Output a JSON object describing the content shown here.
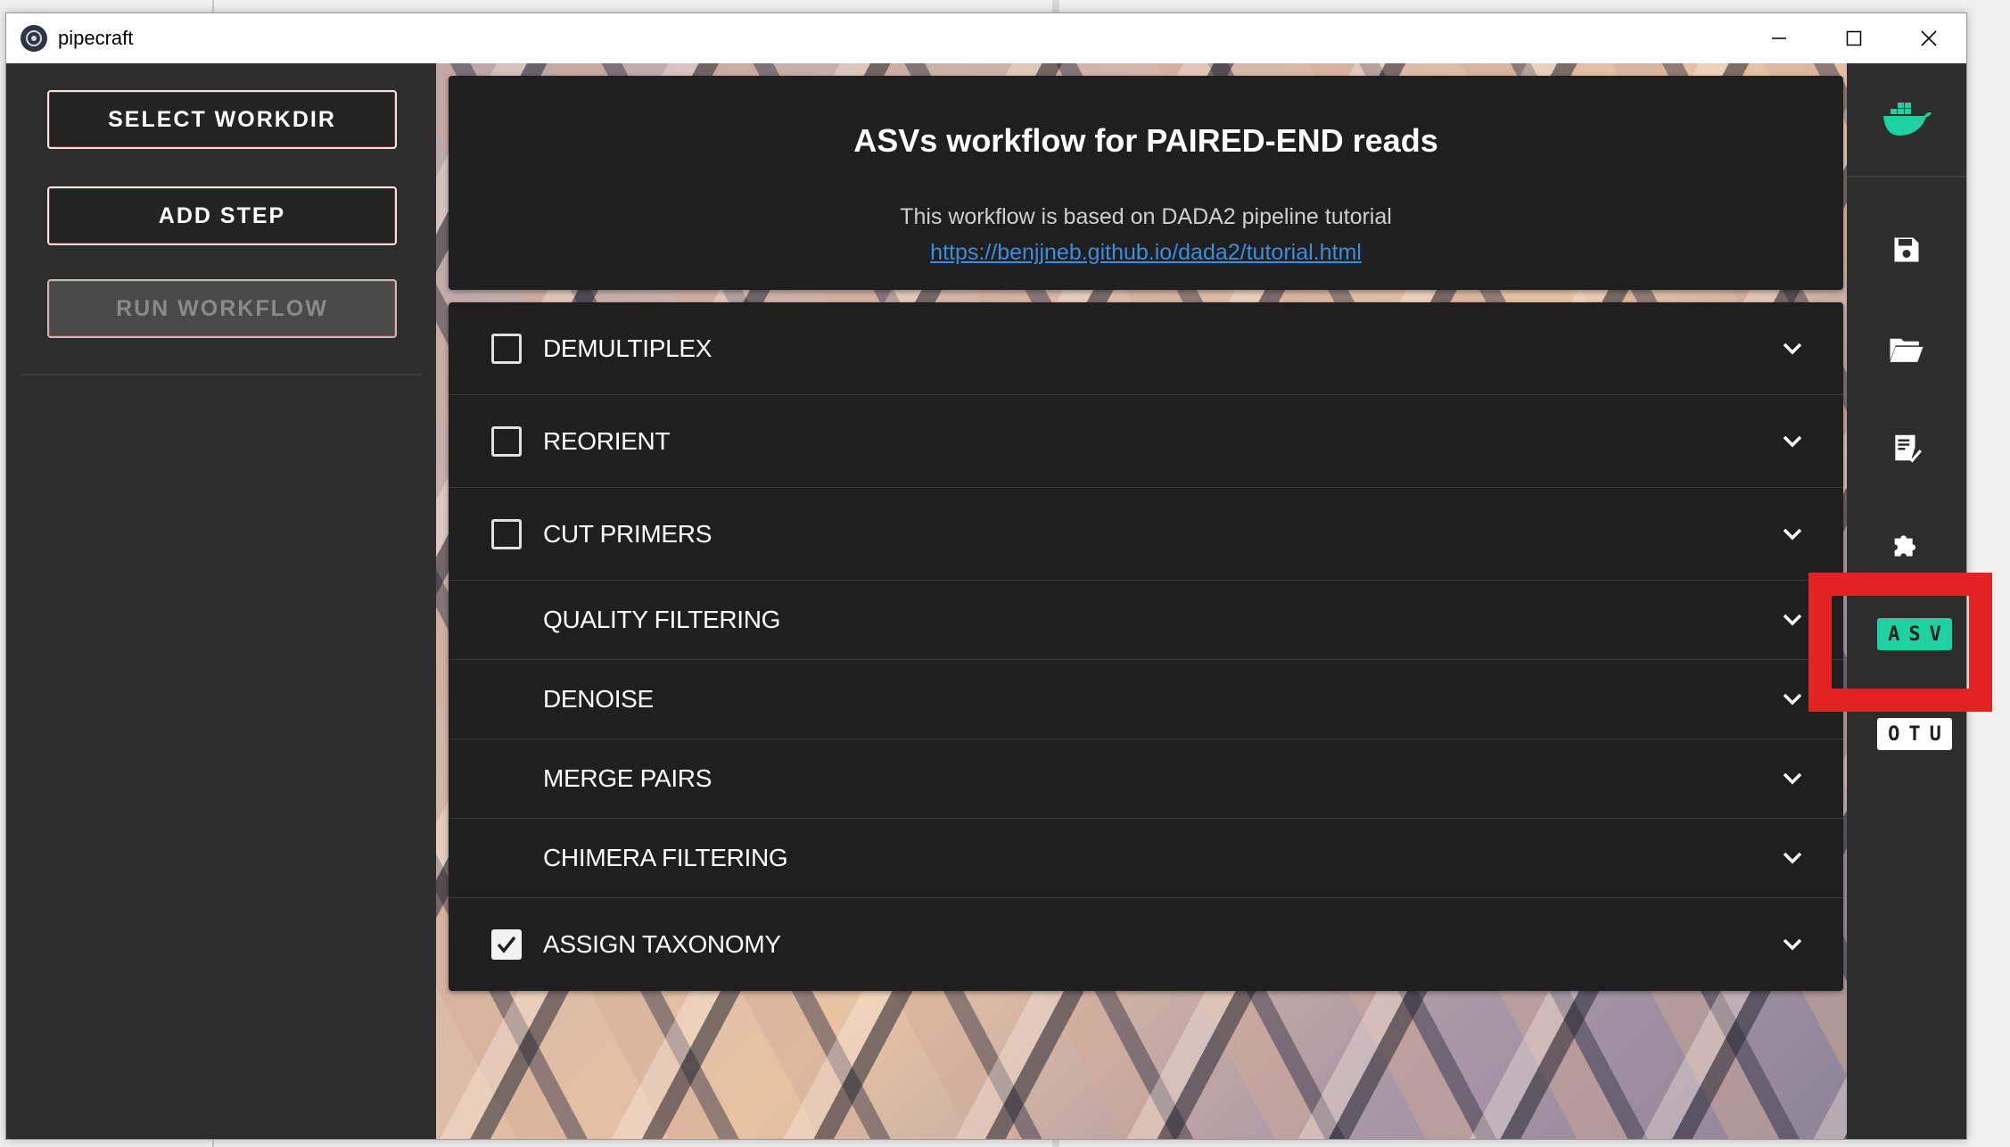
{
  "window": {
    "title": "pipecraft"
  },
  "left_panel": {
    "buttons": [
      {
        "label": "SELECT WORKDIR",
        "enabled": true
      },
      {
        "label": "ADD STEP",
        "enabled": true
      },
      {
        "label": "RUN WORKFLOW",
        "enabled": false
      }
    ]
  },
  "header": {
    "title": "ASVs workflow for PAIRED-END reads",
    "subtitle": "This workflow is based on DADA2 pipeline tutorial",
    "link": "https://benjjneb.github.io/dada2/tutorial.html"
  },
  "steps": [
    {
      "label": "DEMULTIPLEX",
      "has_checkbox": true,
      "checked": false
    },
    {
      "label": "REORIENT",
      "has_checkbox": true,
      "checked": false
    },
    {
      "label": "CUT PRIMERS",
      "has_checkbox": true,
      "checked": false
    },
    {
      "label": "QUALITY FILTERING",
      "has_checkbox": false,
      "checked": false
    },
    {
      "label": "DENOISE",
      "has_checkbox": false,
      "checked": false
    },
    {
      "label": "MERGE PAIRS",
      "has_checkbox": false,
      "checked": false
    },
    {
      "label": "CHIMERA FILTERING",
      "has_checkbox": false,
      "checked": false
    },
    {
      "label": "ASSIGN TAXONOMY",
      "has_checkbox": true,
      "checked": true
    }
  ],
  "right_panel": {
    "icons": [
      "docker-icon",
      "save-icon",
      "folder-open-icon",
      "checklist-icon",
      "puzzle-icon"
    ],
    "badges": {
      "asv": "ASV",
      "otu": "OTU"
    }
  },
  "colors": {
    "accent_teal": "#1dd1a1",
    "highlight_red": "#e32222",
    "link_blue": "#3b8de0"
  }
}
